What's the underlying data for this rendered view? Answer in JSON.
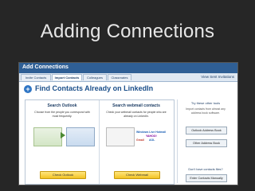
{
  "slide_title": "Adding Connections",
  "header": {
    "title": "Add Connections",
    "view_sent": "View Sent Invitations"
  },
  "tabs": [
    {
      "label": "Invite Contacts"
    },
    {
      "label": "Import Contacts"
    },
    {
      "label": "Colleagues"
    },
    {
      "label": "Classmates"
    }
  ],
  "find_title": "Find Contacts Already on LinkedIn",
  "outlook": {
    "title": "Search Outlook",
    "desc": "Choose from the people you correspond with most frequently.",
    "button": "Check Outlook"
  },
  "webmail": {
    "title": "Search webmail contacts",
    "desc": "Check your webmail contacts for people who are already on LinkedIn.",
    "brands": [
      "Windows Live Hotmail",
      "YAHOO!",
      "Gmail",
      "AOL"
    ],
    "button": "Check Webmail"
  },
  "side": {
    "title": "Try these other tools",
    "desc": "Import contacts from almost any address book software.",
    "btn_outlook": "Outlook Address Book",
    "btn_other": "Other Address Book",
    "question": "Don't have contacts files?",
    "btn_manual": "Enter Contacts Manually"
  }
}
